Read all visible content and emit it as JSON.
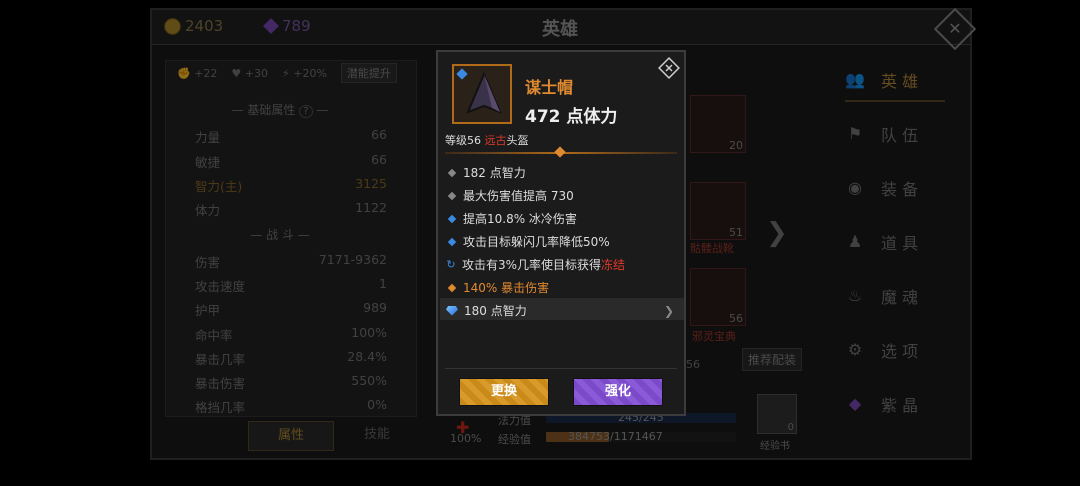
{
  "header": {
    "title": "英雄",
    "gold": "2403",
    "gems": "789"
  },
  "bonus": {
    "a": "+22",
    "b": "+30",
    "c": "+20%",
    "btn": "潜能提升"
  },
  "base_stats": {
    "heading": "基础属性",
    "rows": [
      {
        "label": "力量",
        "value": "66"
      },
      {
        "label": "敏捷",
        "value": "66"
      },
      {
        "label": "智力(主)",
        "value": "3125"
      },
      {
        "label": "体力",
        "value": "1122"
      }
    ]
  },
  "combat": {
    "heading": "战 斗",
    "rows": [
      {
        "label": "伤害",
        "value": "7171-9362"
      },
      {
        "label": "攻击速度",
        "value": "1"
      },
      {
        "label": "护甲",
        "value": "989"
      },
      {
        "label": "命中率",
        "value": "100%"
      },
      {
        "label": "暴击几率",
        "value": "28.4%"
      },
      {
        "label": "暴击伤害",
        "value": "550%"
      },
      {
        "label": "格挡几率",
        "value": "0%"
      }
    ]
  },
  "tabs": {
    "attr": "属性",
    "skill": "技能"
  },
  "nav": [
    "英 雄",
    "队 伍",
    "装 备",
    "道 具",
    "魔 魂",
    "选 项",
    "紫 晶"
  ],
  "middle": {
    "slot1_lvl": "20",
    "slot2_lvl": "51",
    "slot2_name": "骷髅战靴",
    "slot3_lvl": "56",
    "slot3_name": "邪灵宝典",
    "recommend": "推荐配装",
    "hp_pct": "100%",
    "mana_label": "法力值",
    "mana_val": "245/245",
    "exp_label": "经验值",
    "exp_val": "384753/1171467",
    "exp_fill": 0.33,
    "exp_book": "经验书",
    "book_count": "0",
    "stray_num": "56"
  },
  "item": {
    "name": "谋士帽",
    "main": "472 点体力",
    "level_prefix": "等级56 ",
    "rarity": "远古",
    "slot": "头盔",
    "attrs": [
      {
        "text": "182 点智力"
      },
      {
        "text": "最大伤害值提高 730"
      },
      {
        "text": "提高10.8% 冰冷伤害"
      },
      {
        "text": "攻击目标躲闪几率降低50%"
      },
      {
        "text": "攻击有3%几率使目标获得",
        "hl": "冻结"
      },
      {
        "text": "140% 暴击伤害"
      }
    ],
    "socket": "180 点智力",
    "btn_swap": "更换",
    "btn_up": "强化"
  },
  "colors": {
    "accent": "#e08a30",
    "rarity": "#e03a2a",
    "blue_bullet": "#3a8ae0",
    "btn_swap": "#c98a1a",
    "btn_up": "#7a4ac8"
  }
}
